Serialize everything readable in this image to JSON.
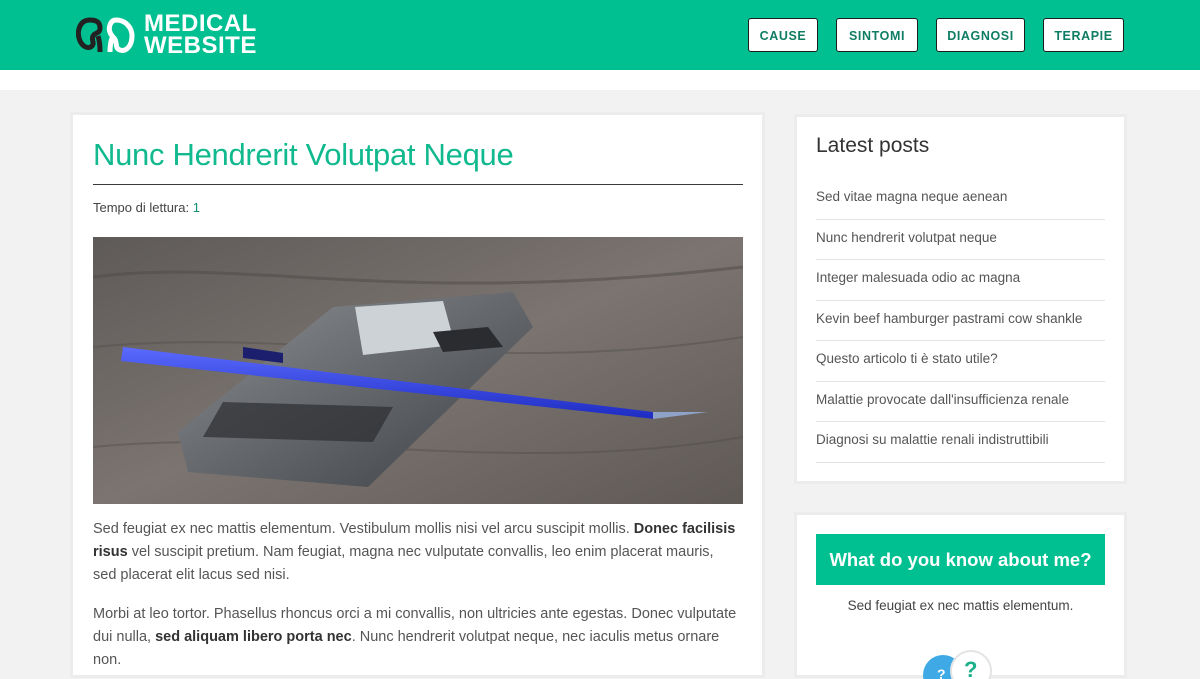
{
  "header": {
    "logo_line1": "MEDICAL",
    "logo_line2": "WEBSITE",
    "nav": [
      "CAUSE",
      "SINTOMI",
      "DIAGNOSI",
      "TERAPIE"
    ]
  },
  "article": {
    "title": "Nunc Hendrerit Volutpat Neque",
    "reading_label": "Tempo di lettura:",
    "reading_value": "1",
    "image_alt": "phone-and-pen-photo",
    "p1_a": "Sed feugiat ex nec mattis elementum. Vestibulum mollis nisi vel arcu suscipit mollis. ",
    "p1_b": "Donec facilisis risus",
    "p1_c": " vel suscipit pretium. Nam feugiat, magna nec vulputate convallis, leo enim placerat mauris, sed placerat elit lacus sed nisi.",
    "p2_a": "Morbi at leo tortor. Phasellus rhoncus orci a mi convallis, non ultricies ante egestas. Donec vulputate dui nulla, ",
    "p2_b": "sed aliquam libero porta nec",
    "p2_c": ". Nunc hendrerit volutpat neque, nec iaculis metus ornare non."
  },
  "sidebar": {
    "latest_title": "Latest posts",
    "posts": [
      "Sed vitae magna neque aenean",
      "Nunc hendrerit volutpat neque",
      "Integer malesuada odio ac magna",
      "Kevin beef hamburger pastrami cow shankle",
      "Questo articolo ti è stato utile?",
      "Malattie provocate dall'insufficienza renale",
      "Diagnosi su malattie renali indistruttibili"
    ],
    "quiz_title": "What do you know about me?",
    "quiz_text": "Sed feugiat ex nec mattis elementum."
  },
  "colors": {
    "brand": "#00c091",
    "title": "#11b98e"
  }
}
